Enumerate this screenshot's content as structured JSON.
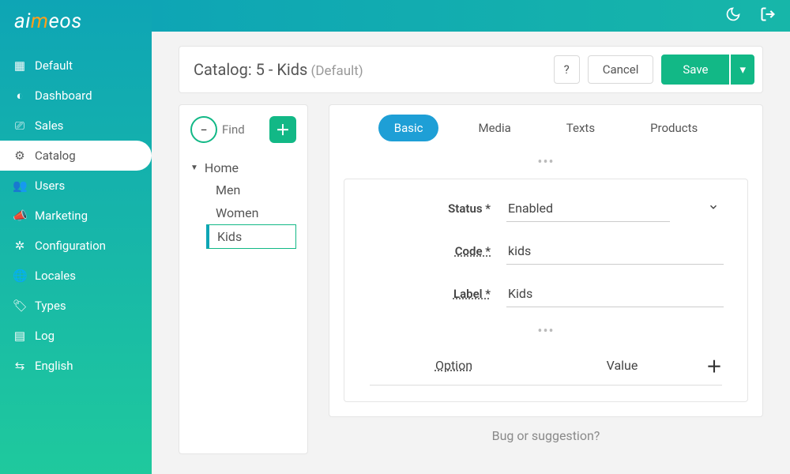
{
  "brand": {
    "ai": "ai",
    "m": "m",
    "eos": "eos"
  },
  "sidebar": {
    "items": [
      {
        "label": "Default",
        "icon": "calendar"
      },
      {
        "label": "Dashboard",
        "icon": "gauge"
      },
      {
        "label": "Sales",
        "icon": "money"
      },
      {
        "label": "Catalog",
        "icon": "cubes",
        "active": true
      },
      {
        "label": "Users",
        "icon": "users"
      },
      {
        "label": "Marketing",
        "icon": "bullhorn"
      },
      {
        "label": "Configuration",
        "icon": "gears"
      },
      {
        "label": "Locales",
        "icon": "globe"
      },
      {
        "label": "Types",
        "icon": "tag"
      },
      {
        "label": "Log",
        "icon": "archive"
      },
      {
        "label": "English",
        "icon": "lang"
      }
    ]
  },
  "header": {
    "title_prefix": "Catalog: ",
    "title_main": "5 - Kids",
    "title_suffix": " (Default)",
    "help": "?",
    "cancel": "Cancel",
    "save": "Save",
    "dd": "▾"
  },
  "tree": {
    "find_placeholder": "Find",
    "collapse_glyph": "−",
    "add_glyph": "＋",
    "caret": "▼",
    "root": "Home",
    "children": [
      "Men",
      "Women",
      "Kids"
    ],
    "selected": "Kids"
  },
  "tabs": [
    "Basic",
    "Media",
    "Texts",
    "Products"
  ],
  "active_tab": "Basic",
  "drag_glyph": "•••",
  "fields": {
    "status": {
      "label": "Status *",
      "value": "Enabled"
    },
    "code": {
      "label": "Code *",
      "value": "kids"
    },
    "label": {
      "label": "Label *",
      "value": "Kids"
    }
  },
  "options": {
    "option_h": "Option",
    "value_h": "Value",
    "add_glyph": "＋"
  },
  "footer": "Bug or suggestion?",
  "topicons": {
    "moon": "moon",
    "logout": "logout"
  }
}
